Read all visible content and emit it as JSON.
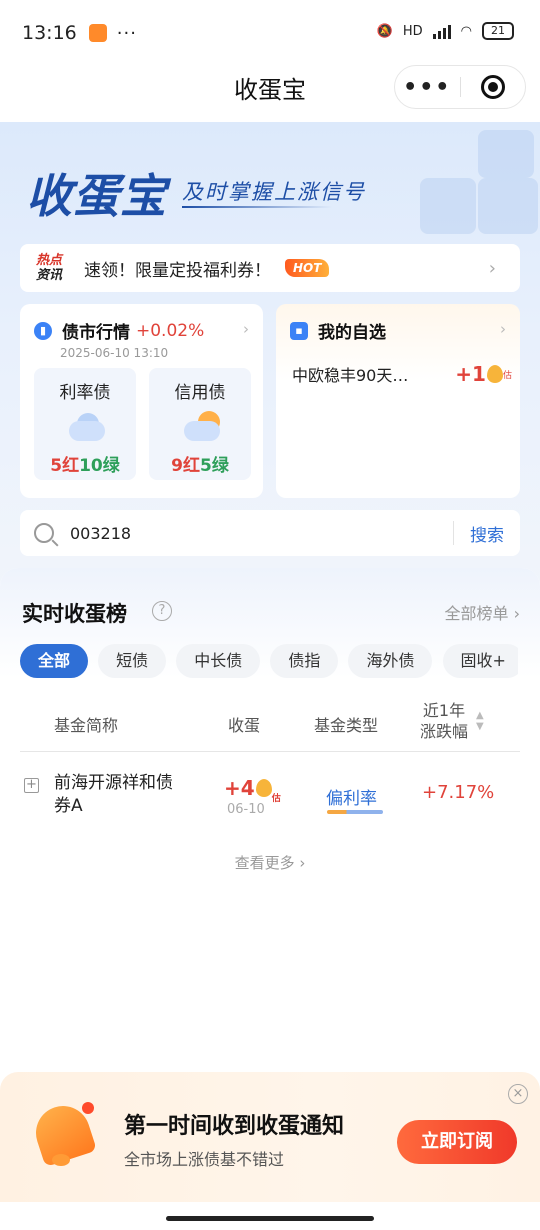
{
  "status": {
    "time": "13:16",
    "dots": "···",
    "network": "HD",
    "battery": "21"
  },
  "nav": {
    "title": "收蛋宝",
    "more": "•••"
  },
  "banner": {
    "title": "收蛋宝",
    "slogan": "及时掌握上涨信号"
  },
  "hot": {
    "tag_top": "热点",
    "tag_bottom": "资讯",
    "text": "速领！限量定投福利券！",
    "badge": "HOT"
  },
  "bond_market": {
    "title": "债市行情",
    "delta": "+0.02%",
    "date": "2025-06-10 13:10",
    "rate": {
      "label": "利率债",
      "red": "5红",
      "green": "10绿"
    },
    "credit": {
      "label": "信用债",
      "red": "9红",
      "green": "5绿"
    }
  },
  "favorites": {
    "title": "我的自选",
    "item_name": "中欧稳丰90天…",
    "item_value": "+1",
    "est": "估"
  },
  "search": {
    "value": "003218",
    "button": "搜索"
  },
  "ranking": {
    "title": "实时收蛋榜",
    "all_label": "全部榜单 ›",
    "tabs": [
      "全部",
      "短债",
      "中长债",
      "债指",
      "海外债",
      "固收+"
    ],
    "headers": {
      "name": "基金简称",
      "egg": "收蛋",
      "type": "基金类型",
      "change_1": "近1年",
      "change_2": "涨跌幅"
    },
    "rows": [
      {
        "name": "前海开源祥和债券A",
        "egg": "+4",
        "est": "估",
        "date": "06-10",
        "type": "偏利率",
        "change": "+7.17%"
      }
    ],
    "see_more": "查看更多 ›"
  },
  "subscribe": {
    "title": "第一时间收到收蛋通知",
    "desc": "全市场上涨债基不错过",
    "button": "立即订阅"
  },
  "colors": {
    "primary": "#2f6fd6",
    "up": "#e0433a",
    "down": "#2e9f5a",
    "brand": "#1d4ea6"
  }
}
